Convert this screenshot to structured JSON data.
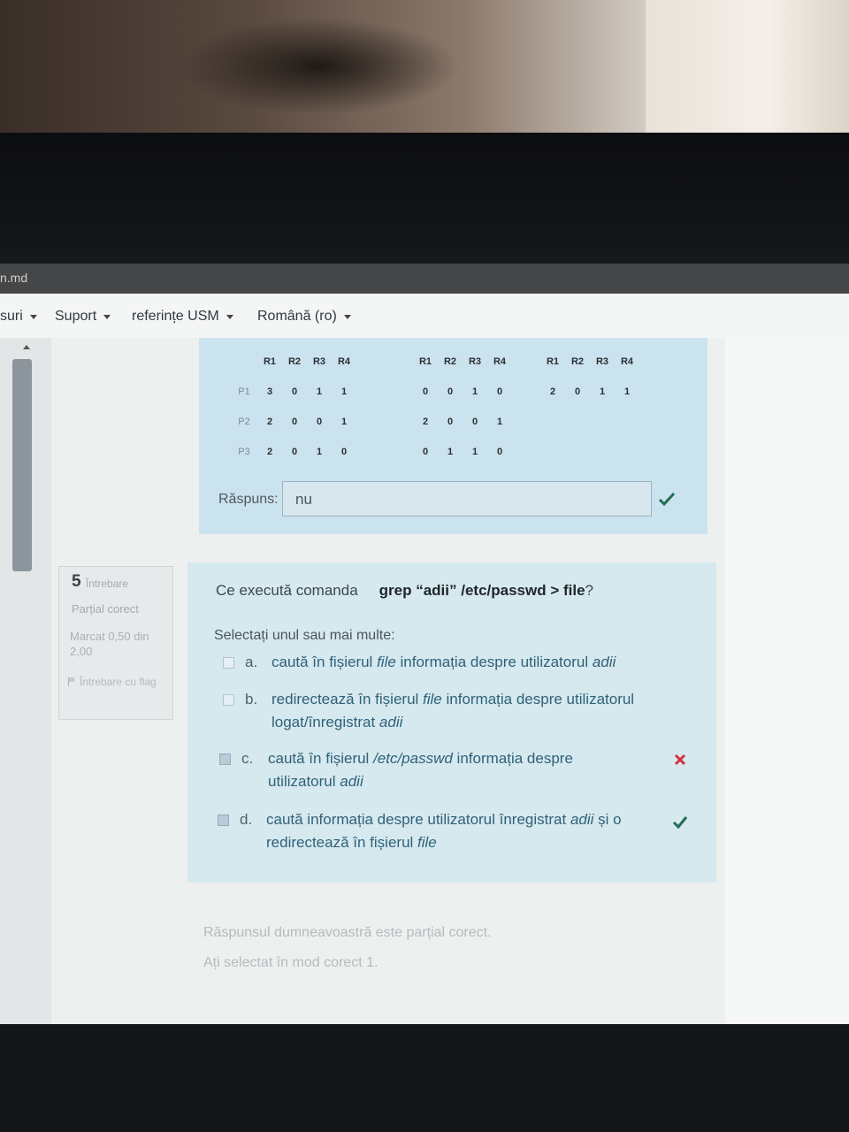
{
  "browser": {
    "url": "n.md"
  },
  "nav": {
    "items": [
      {
        "label": "suri"
      },
      {
        "label": "Suport"
      },
      {
        "label": "referințe USM"
      },
      {
        "label": "Română (ro)"
      }
    ]
  },
  "prev_question": {
    "matrices": [
      {
        "col_headers": [
          "R1",
          "R2",
          "R3",
          "R4"
        ],
        "row_labels": [
          "P1",
          "P2",
          "P3"
        ],
        "rows": [
          [
            "3",
            "0",
            "1",
            "1"
          ],
          [
            "2",
            "0",
            "0",
            "1"
          ],
          [
            "2",
            "0",
            "1",
            "0"
          ]
        ]
      },
      {
        "col_headers": [
          "R1",
          "R2",
          "R3",
          "R4"
        ],
        "row_labels": [],
        "rows": [
          [
            "0",
            "0",
            "1",
            "0"
          ],
          [
            "2",
            "0",
            "0",
            "1"
          ],
          [
            "0",
            "1",
            "1",
            "0"
          ]
        ]
      },
      {
        "col_headers": [
          "R1",
          "R2",
          "R3",
          "R4"
        ],
        "row_labels": [],
        "rows": [
          [
            "2",
            "0",
            "1",
            "1"
          ]
        ]
      }
    ],
    "answer_label": "Răspuns:",
    "answer_value": "nu"
  },
  "question_info": {
    "number": "5",
    "word": "Întrebare",
    "state": "Parțial corect",
    "grade": "Marcat 0,50 din 2,00",
    "flag": "Întrebare cu flag"
  },
  "question": {
    "text": "Ce execută comanda",
    "command": "grep “adii” /etc/passwd > file",
    "suffix": "?",
    "prompt": "Selectați unul sau mai multe:",
    "options": {
      "a": {
        "letter": "a.",
        "pre": "caută în fișierul ",
        "em1": "file",
        "mid": " informația despre utilizatorul ",
        "em2": "adii",
        "post": ""
      },
      "b": {
        "letter": "b.",
        "pre": "redirectează în fișierul ",
        "em1": "file",
        "mid": " informația despre utilizatorul logat/înregistrat ",
        "em2": "adii",
        "post": ""
      },
      "c": {
        "letter": "c.",
        "pre": "caută în fișierul ",
        "em1": "/etc/passwd",
        "mid": " informația despre utilizatorul ",
        "em2": "adii",
        "post": ""
      },
      "d": {
        "letter": "d.",
        "pre": "caută informația despre utilizatorul înregistrat ",
        "em1": "adii",
        "mid": " și o redirectează în fișierul ",
        "em2": "file",
        "post": ""
      }
    }
  },
  "feedback": {
    "line1": "Răspunsul dumneavoastră este parțial corect.",
    "line2": "Ați selectat în mod corect 1."
  },
  "colors": {
    "correct": "#1f6e53",
    "incorrect": "#d3323f",
    "card": "#d6e9ef"
  }
}
